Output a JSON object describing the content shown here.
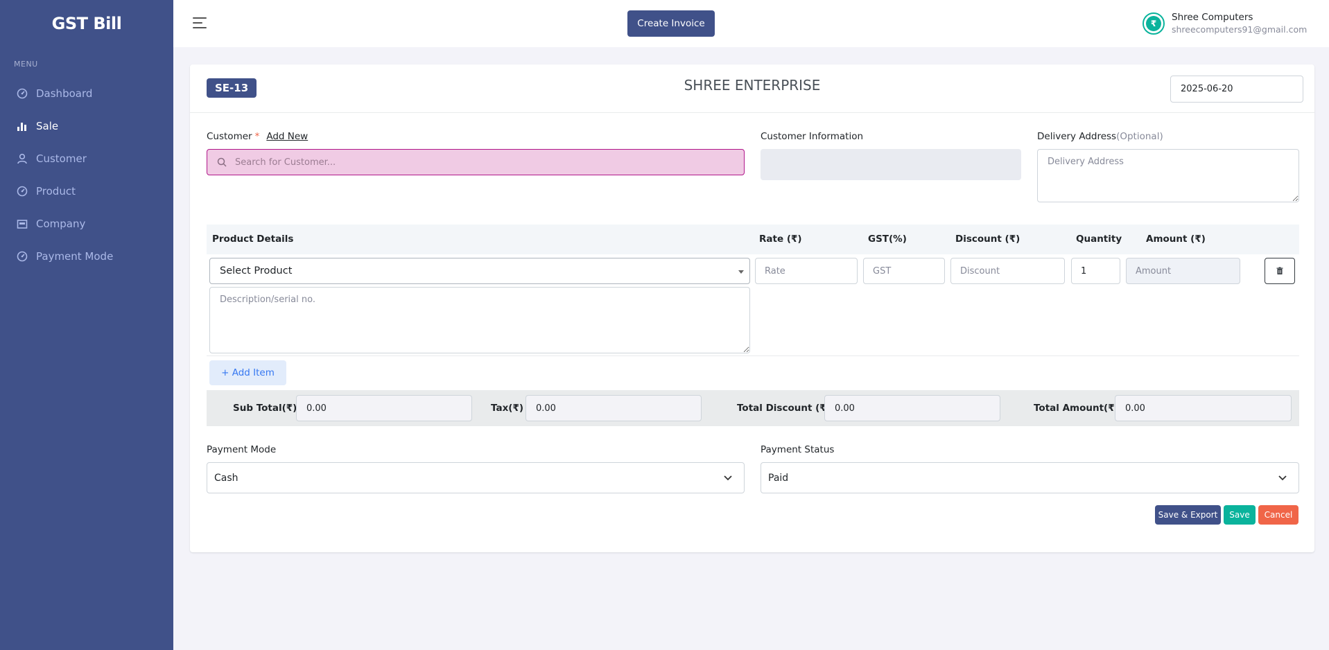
{
  "sidebar": {
    "brand": "GST Bill",
    "menu_title": "MENU",
    "items": [
      {
        "label": "Dashboard",
        "icon": "gauge-icon",
        "active": false
      },
      {
        "label": "Sale",
        "icon": "bar-chart-icon",
        "active": true
      },
      {
        "label": "Customer",
        "icon": "user-icon",
        "active": false
      },
      {
        "label": "Product",
        "icon": "gauge-icon",
        "active": false
      },
      {
        "label": "Company",
        "icon": "building-icon",
        "active": false
      },
      {
        "label": "Payment Mode",
        "icon": "gauge-icon",
        "active": false
      }
    ]
  },
  "topbar": {
    "create_invoice": "Create Invoice",
    "user_name": "Shree Computers",
    "user_email": "shreecomputers91@gmail.com",
    "avatar_symbol": "₹"
  },
  "invoice": {
    "number": "SE-13",
    "company": "SHREE ENTERPRISE",
    "date": "2025-06-20"
  },
  "customer": {
    "label": "Customer",
    "required_mark": "*",
    "add_new": "Add New",
    "search_placeholder": "Search for Customer...",
    "info_label": "Customer Information",
    "delivery_label": "Delivery Address",
    "delivery_optional": "(Optional)",
    "delivery_placeholder": "Delivery Address"
  },
  "table": {
    "headers": {
      "product": "Product Details",
      "rate": "Rate (₹)",
      "gst": "GST(%)",
      "discount": "Discount (₹)",
      "quantity": "Quantity",
      "amount": "Amount (₹)"
    },
    "row": {
      "product_select": "Select Product",
      "rate_placeholder": "Rate",
      "gst_placeholder": "GST",
      "discount_placeholder": "Discount",
      "quantity": "1",
      "amount_placeholder": "Amount",
      "description_placeholder": "Description/serial no."
    },
    "add_item": "+  Add Item"
  },
  "totals": {
    "sub_total_label": "Sub Total(₹)",
    "sub_total": "0.00",
    "tax_label": "Tax(₹)",
    "tax": "0.00",
    "discount_label": "Total Discount (₹)",
    "discount": "0.00",
    "amount_label": "Total Amount(₹)",
    "amount": "0.00"
  },
  "payment": {
    "mode_label": "Payment Mode",
    "mode_value": "Cash",
    "status_label": "Payment Status",
    "status_value": "Paid"
  },
  "actions": {
    "save_export": "Save & Export",
    "save": "Save",
    "cancel": "Cancel"
  },
  "colors": {
    "primary": "#405189",
    "success": "#0ab39c",
    "danger": "#f06548",
    "info": "#3577f1"
  }
}
